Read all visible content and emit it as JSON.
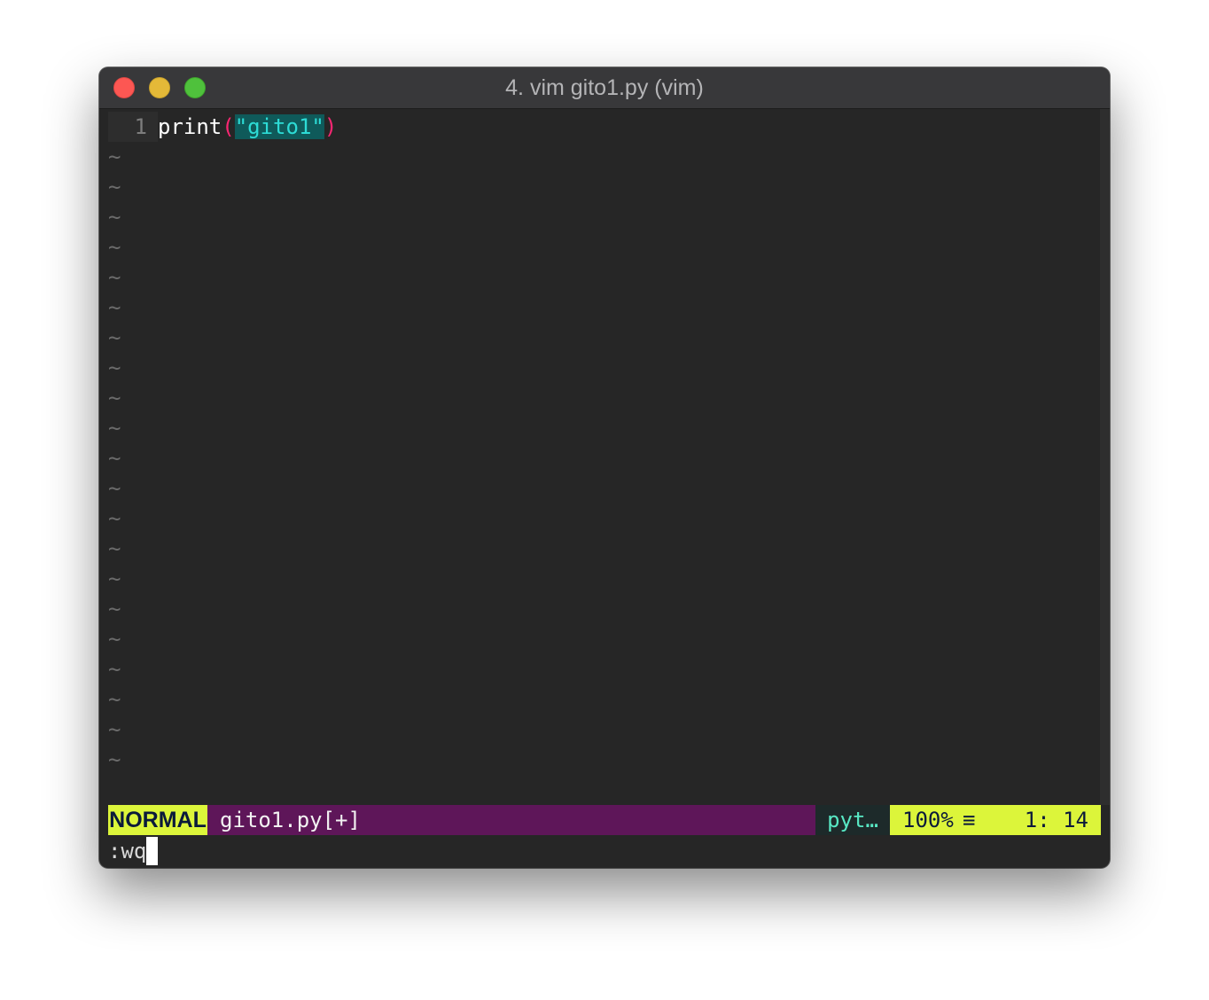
{
  "window": {
    "title": "4. vim gito1.py (vim)"
  },
  "editor": {
    "line_number": "1",
    "code_prefix": "print",
    "open_paren": "(",
    "string_literal": "\"gito1\"",
    "close_paren": ")",
    "empty_line_marker": "~",
    "empty_line_count": 21
  },
  "statusline": {
    "mode": "NORMAL",
    "filename": "gito1.py[+]",
    "filetype": "pyt…",
    "percent": "100%",
    "hamburger": "≡",
    "line_col": "1: 14"
  },
  "cmdline": {
    "text": ":wq"
  },
  "colors": {
    "background": "#262626",
    "mode_bg": "#dcf53a",
    "file_bg": "#5e1659",
    "string": "#2ddcd6",
    "paren": "#f92672"
  }
}
